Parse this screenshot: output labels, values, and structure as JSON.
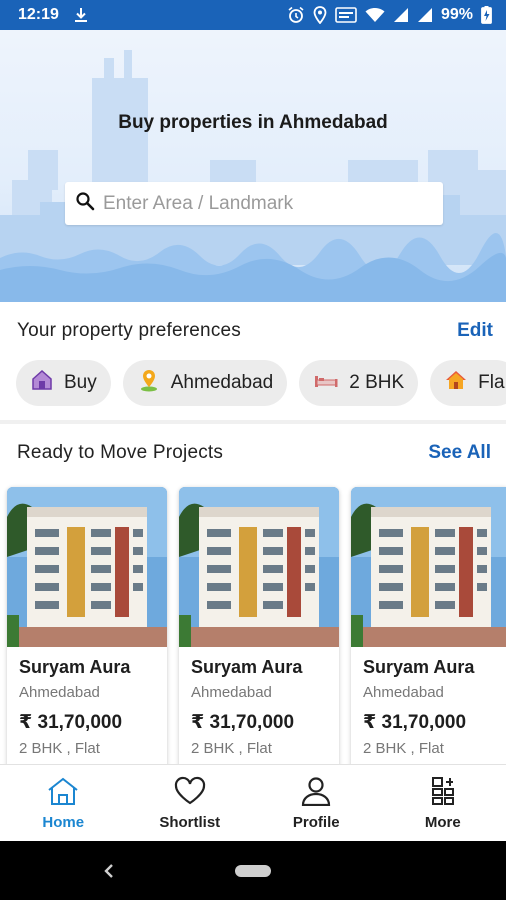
{
  "status_bar": {
    "time": "12:19",
    "battery": "99%",
    "icons": [
      "download-icon",
      "alarm-icon",
      "location-icon",
      "volte-icon",
      "wifi-icon",
      "signal-icon",
      "signal-icon",
      "battery-icon"
    ]
  },
  "hero": {
    "title": "Buy properties in Ahmedabad",
    "search_placeholder": "Enter Area / Landmark"
  },
  "preferences": {
    "title": "Your property preferences",
    "edit_label": "Edit",
    "chips": [
      {
        "label": "Buy",
        "icon": "house-icon"
      },
      {
        "label": "Ahmedabad",
        "icon": "location-pin-icon"
      },
      {
        "label": "2 BHK",
        "icon": "bed-icon"
      },
      {
        "label": "Fla",
        "icon": "home-icon"
      }
    ]
  },
  "projects": {
    "title": "Ready to Move Projects",
    "see_all_label": "See All",
    "items": [
      {
        "name": "Suryam Aura",
        "city": "Ahmedabad",
        "price": "₹ 31,70,000",
        "config": "2 BHK , Flat"
      },
      {
        "name": "Suryam Aura",
        "city": "Ahmedabad",
        "price": "₹ 31,70,000",
        "config": "2 BHK , Flat"
      },
      {
        "name": "Suryam Aura",
        "city": "Ahmedabad",
        "price": "₹ 31,70,000",
        "config": "2 BHK , Flat"
      }
    ]
  },
  "bottom_nav": {
    "items": [
      {
        "label": "Home",
        "icon": "home-icon",
        "active": true
      },
      {
        "label": "Shortlist",
        "icon": "heart-icon",
        "active": false
      },
      {
        "label": "Profile",
        "icon": "user-icon",
        "active": false
      },
      {
        "label": "More",
        "icon": "more-icon",
        "active": false
      }
    ]
  },
  "colors": {
    "brand_blue": "#1a63b8",
    "active_nav": "#1b86d1",
    "chip_bg": "#ececec"
  }
}
